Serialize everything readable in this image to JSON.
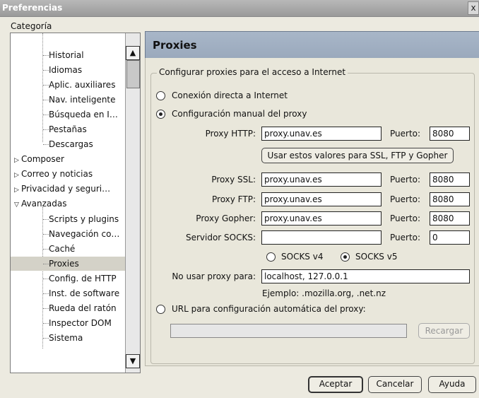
{
  "window": {
    "title": "Preferencias",
    "close_label": "x"
  },
  "sidebar": {
    "label": "Categoría",
    "items": [
      {
        "label": "Historial"
      },
      {
        "label": "Idiomas"
      },
      {
        "label": "Aplic. auxiliares"
      },
      {
        "label": "Nav. inteligente"
      },
      {
        "label": "Búsqueda en I…"
      },
      {
        "label": "Pestañas"
      },
      {
        "label": "Descargas"
      },
      {
        "label": "Composer"
      },
      {
        "label": "Correo y noticias"
      },
      {
        "label": "Privacidad y seguri…"
      },
      {
        "label": "Avanzadas"
      },
      {
        "label": "Scripts y plugins"
      },
      {
        "label": "Navegación co…"
      },
      {
        "label": "Caché"
      },
      {
        "label": "Proxies",
        "selected": true
      },
      {
        "label": "Config. de HTTP"
      },
      {
        "label": "Inst. de software"
      },
      {
        "label": "Rueda del ratón"
      },
      {
        "label": "Inspector DOM"
      },
      {
        "label": "Sistema"
      }
    ]
  },
  "panel": {
    "title": "Proxies",
    "group_label": "Configurar proxies para el acceso a Internet",
    "direct_label": "Conexión directa a Internet",
    "manual_label": "Configuración manual del proxy",
    "http_label": "Proxy HTTP:",
    "http_value": "proxy.unav.es",
    "port_label": "Puerto:",
    "http_port": "8080",
    "use_same_button": "Usar estos valores para SSL, FTP y Gopher",
    "ssl_label": "Proxy SSL:",
    "ssl_value": "proxy.unav.es",
    "ssl_port": "8080",
    "ftp_label": "Proxy FTP:",
    "ftp_value": "proxy.unav.es",
    "ftp_port": "8080",
    "gopher_label": "Proxy Gopher:",
    "gopher_value": "proxy.unav.es",
    "gopher_port": "8080",
    "socks_label": "Servidor SOCKS:",
    "socks_value": "",
    "socks_port": "0",
    "socks_v4": "SOCKS v4",
    "socks_v5": "SOCKS v5",
    "noproxy_label": "No usar proxy para:",
    "noproxy_value": "localhost, 127.0.0.1",
    "example": "Ejemplo: .mozilla.org, .net.nz",
    "auto_label": "URL para configuración automática del proxy:",
    "auto_value": "",
    "reload_button": "Recargar"
  },
  "footer": {
    "ok": "Aceptar",
    "cancel": "Cancelar",
    "help": "Ayuda"
  }
}
